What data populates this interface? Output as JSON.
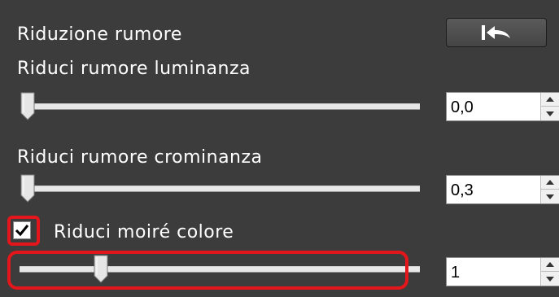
{
  "section": {
    "title": "Riduzione rumore",
    "reset_icon": "undo-arrow-icon"
  },
  "luminance": {
    "label": "Riduci rumore luminanza",
    "value": "0,0",
    "slider_fraction": 0.0
  },
  "chrominance": {
    "label": "Riduci rumore crominanza",
    "value": "0,3",
    "slider_fraction": 0.0
  },
  "moire": {
    "label": "Riduci moiré colore",
    "checked": true,
    "value": "1",
    "slider_fraction": 0.2
  },
  "colors": {
    "background": "#3c3c3c",
    "highlight": "#e3161b",
    "text": "#ffffff"
  }
}
